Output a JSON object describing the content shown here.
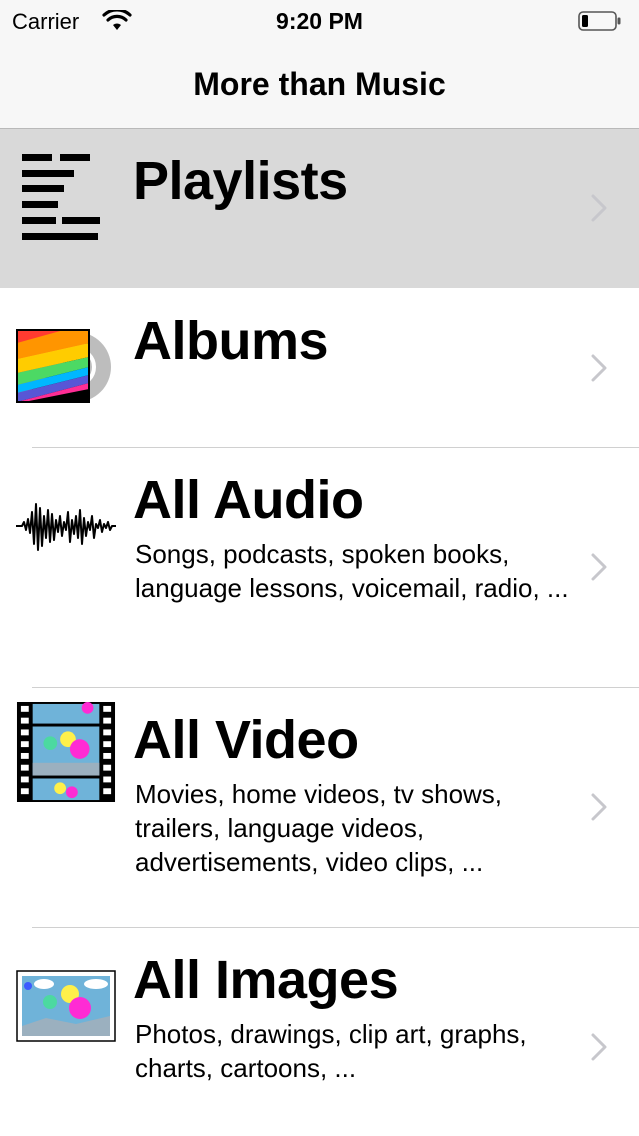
{
  "status_bar": {
    "carrier": "Carrier",
    "time": "9:20 PM",
    "wifi_icon": "wifi-icon",
    "battery_icon": "battery-low-icon"
  },
  "nav": {
    "title": "More than Music"
  },
  "rows": [
    {
      "title": "Playlists",
      "subtitle": "",
      "icon": "playlist-lines-icon",
      "selected": true
    },
    {
      "title": "Albums",
      "subtitle": "",
      "icon": "album-cover-icon",
      "selected": false
    },
    {
      "title": "All Audio",
      "subtitle": "Songs, podcasts, spoken books, language lessons, voicemail, radio, ...",
      "icon": "audio-waveform-icon",
      "selected": false
    },
    {
      "title": "All Video",
      "subtitle": "Movies, home videos, tv shows, trailers, language videos, advertisements, video clips, ...",
      "icon": "film-strip-icon",
      "selected": false
    },
    {
      "title": "All Images",
      "subtitle": "Photos, drawings, clip art, graphs, charts, cartoons, ...",
      "icon": "picture-icon",
      "selected": false
    }
  ],
  "colors": {
    "bar_background": "#f7f7f7",
    "selected_row": "#d9d9d9",
    "separator": "#d0d0d0",
    "chevron": "#c7c7cc"
  }
}
